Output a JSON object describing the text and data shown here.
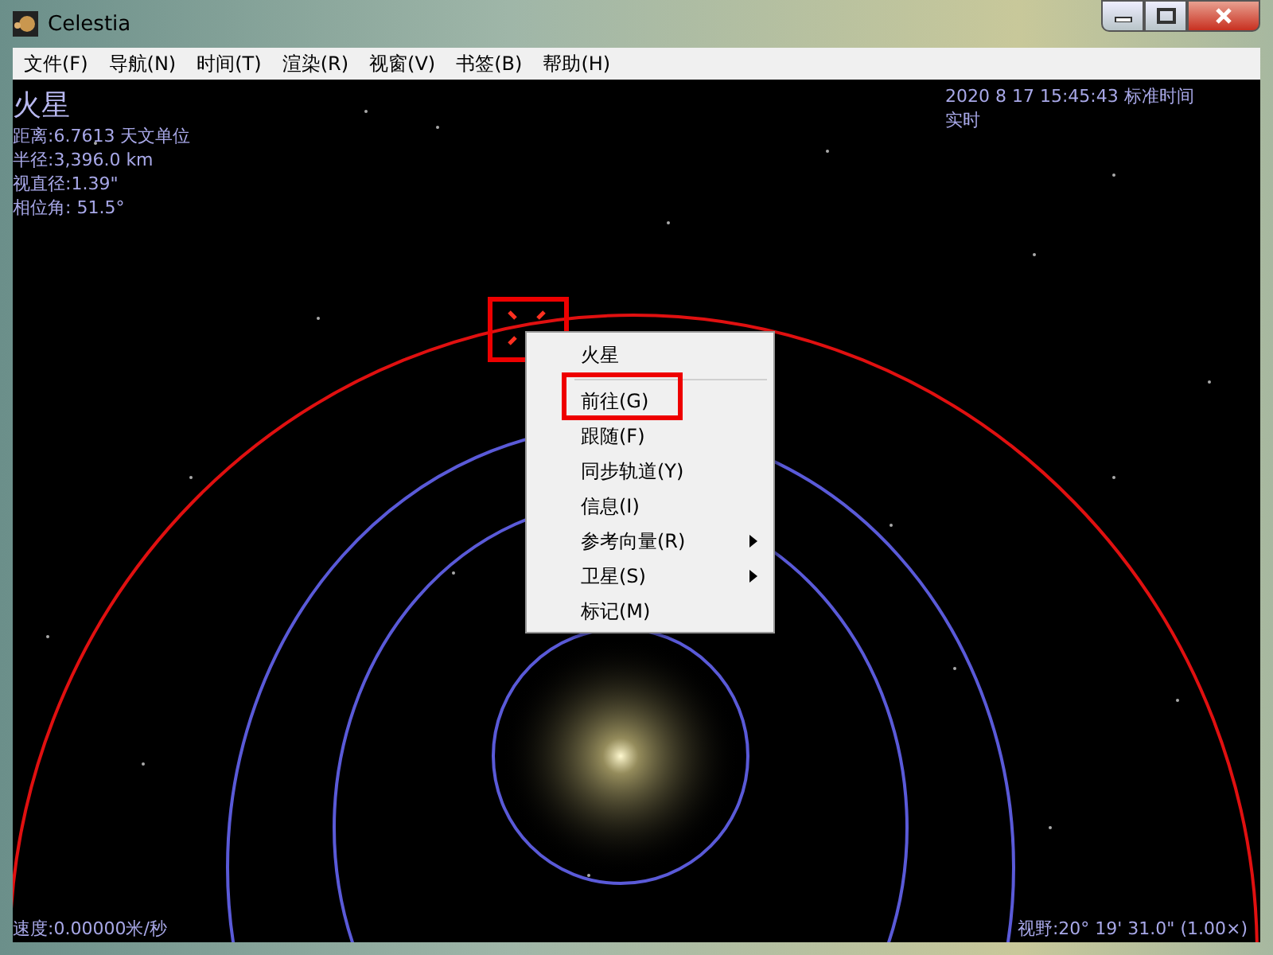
{
  "window": {
    "title": "Celestia"
  },
  "menu_bar": [
    {
      "label": "文件(F)"
    },
    {
      "label": "导航(N)"
    },
    {
      "label": "时间(T)"
    },
    {
      "label": "渲染(R)"
    },
    {
      "label": "视窗(V)"
    },
    {
      "label": "书签(B)"
    },
    {
      "label": "帮助(H)"
    }
  ],
  "overlay": {
    "object_name": "火星",
    "info": [
      "距离:6.7613 天文单位",
      "半径:3,396.0 km",
      "视直径:1.39\"",
      "相位角: 51.5°"
    ],
    "datetime": "2020 8 17 15:45:43 标准时间",
    "time_mode": "实时",
    "speed": "速度:0.00000米/秒",
    "field_of_view": "视野:20° 19' 31.0\" (1.00×)"
  },
  "context_menu": {
    "title": "火星",
    "items": [
      {
        "label": "前往(G)",
        "submenu": false
      },
      {
        "label": "跟随(F)",
        "submenu": false
      },
      {
        "label": "同步轨道(Y)",
        "submenu": false
      },
      {
        "label": "信息(I)",
        "submenu": false
      },
      {
        "label": "参考向量(R)",
        "submenu": true
      },
      {
        "label": "卫星(S)",
        "submenu": true
      },
      {
        "label": "标记(M)",
        "submenu": false
      }
    ]
  }
}
